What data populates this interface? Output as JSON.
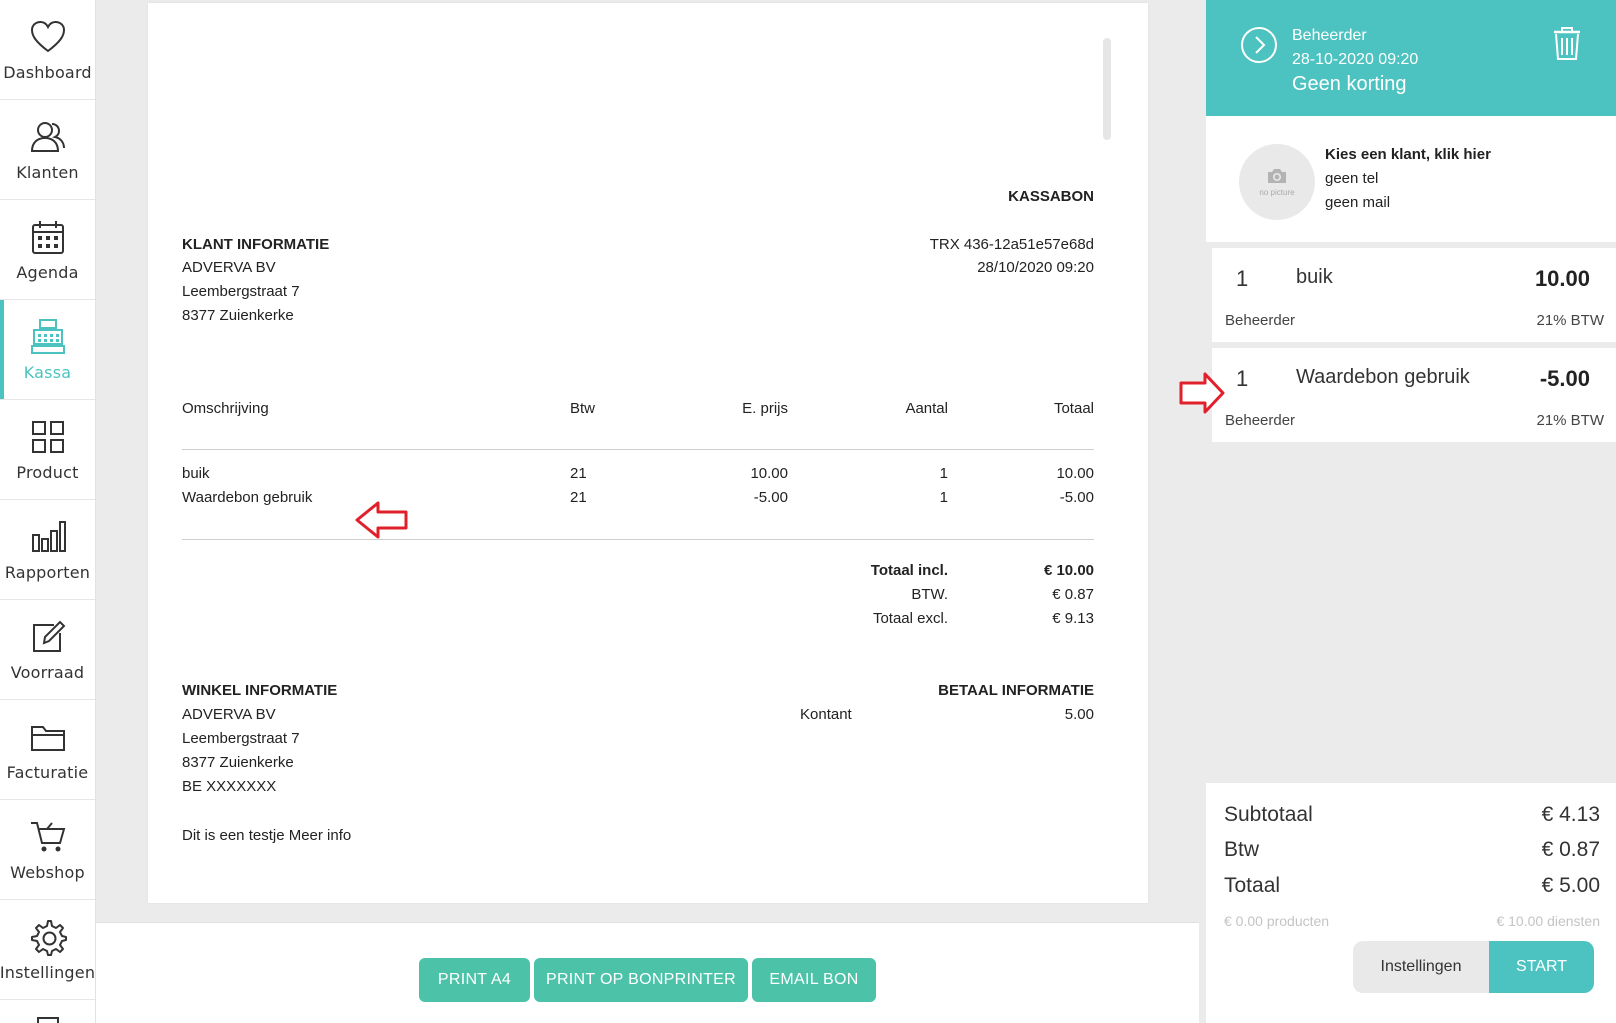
{
  "nav": {
    "items": [
      {
        "label": "Dashboard",
        "icon": "heart-icon"
      },
      {
        "label": "Klanten",
        "icon": "users-icon"
      },
      {
        "label": "Agenda",
        "icon": "calendar-icon"
      },
      {
        "label": "Kassa",
        "icon": "cash-register-icon",
        "active": true
      },
      {
        "label": "Product",
        "icon": "grid-icon"
      },
      {
        "label": "Rapporten",
        "icon": "bar-chart-icon"
      },
      {
        "label": "Voorraad",
        "icon": "edit-icon"
      },
      {
        "label": "Facturatie",
        "icon": "folder-icon"
      },
      {
        "label": "Webshop",
        "icon": "cart-icon"
      },
      {
        "label": "Instellingen",
        "icon": "gear-icon"
      }
    ]
  },
  "receipt": {
    "title": "KASSABON",
    "client_heading": "KLANT INFORMATIE",
    "client_lines": [
      "ADVERVA BV",
      "Leembergstraat 7",
      "8377 Zuienkerke"
    ],
    "trx": "TRX 436-12a51e57e68d",
    "datetime": "28/10/2020 09:20",
    "columns": {
      "description": "Omschrijving",
      "vat": "Btw",
      "unit_price": "E. prijs",
      "quantity": "Aantal",
      "total": "Totaal"
    },
    "rows": [
      {
        "description": "buik",
        "vat": "21",
        "unit_price": "10.00",
        "quantity": "1",
        "total": "10.00"
      },
      {
        "description": "Waardebon gebruik",
        "vat": "21",
        "unit_price": "-5.00",
        "quantity": "1",
        "total": "-5.00"
      }
    ],
    "totals": [
      {
        "label": "Totaal incl.",
        "value": "€ 10.00",
        "bold": true
      },
      {
        "label": "BTW.",
        "value": "€ 0.87"
      },
      {
        "label": "Totaal excl.",
        "value": "€ 9.13"
      }
    ],
    "shop_heading": "WINKEL INFORMATIE",
    "shop_lines": [
      "ADVERVA BV",
      "Leembergstraat 7",
      "8377 Zuienkerke",
      "BE XXXXXXX"
    ],
    "payment_heading": "BETAAL INFORMATIE",
    "payment_method": "Kontant",
    "payment_amount": "5.00",
    "footer_note": "Dit is een testje Meer info"
  },
  "actions": {
    "print_a4": "PRINT A4",
    "print_bon": "PRINT OP BONPRINTER",
    "email": "EMAIL BON"
  },
  "panel": {
    "header": {
      "user": "Beheerder",
      "datetime": "28-10-2020 09:20",
      "discount": "Geen korting"
    },
    "customer": {
      "avatar_text": "no picture",
      "prompt": "Kies een klant, klik hier",
      "phone": "geen tel",
      "mail": "geen mail"
    },
    "items": [
      {
        "qty": "1",
        "name": "buik",
        "price": "10.00",
        "employee": "Beheerder",
        "vat": "21% BTW"
      },
      {
        "qty": "1",
        "name": "Waardebon gebruik",
        "price": "-5.00",
        "employee": "Beheerder",
        "vat": "21% BTW"
      }
    ],
    "totals": {
      "subtotal_label": "Subtotaal",
      "subtotal": "€ 4.13",
      "vat_label": "Btw",
      "vat": "€ 0.87",
      "total_label": "Totaal",
      "total": "€ 5.00",
      "products": "€ 0.00 producten",
      "services": "€ 10.00 diensten"
    },
    "buttons": {
      "settings": "Instellingen",
      "start": "START"
    }
  },
  "colors": {
    "accent": "#4cc3c0",
    "button": "#4cc3a9",
    "arrow": "#e0202a"
  }
}
